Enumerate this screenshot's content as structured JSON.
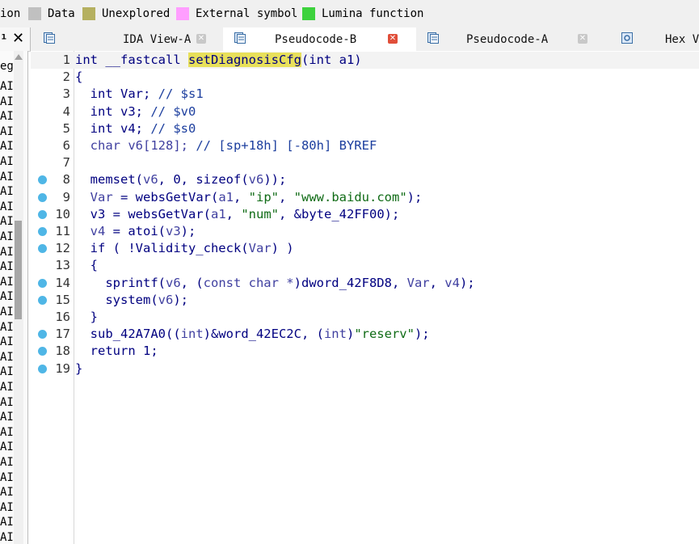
{
  "legend": [
    {
      "label": "ion",
      "color": ""
    },
    {
      "label": "Data",
      "color": "#c0c0c0"
    },
    {
      "label": "Unexplored",
      "color": "#b5b060"
    },
    {
      "label": "External symbol",
      "color": "#ff9eff"
    },
    {
      "label": "Lumina function",
      "color": "#3dd23d"
    }
  ],
  "tabs": [
    {
      "label": "IDA View-A",
      "icon": "disassembly-view-icon",
      "active": false,
      "close": "grey"
    },
    {
      "label": "Pseudocode-B",
      "icon": "pseudocode-icon",
      "active": true,
      "close": "red"
    },
    {
      "label": "Pseudocode-A",
      "icon": "pseudocode-icon",
      "active": false,
      "close": "grey"
    },
    {
      "label": "Hex V",
      "icon": "hex-view-icon",
      "active": false,
      "close": "none"
    }
  ],
  "left_panel": {
    "header_pin": "¹",
    "header_close": "✕",
    "first_row": "eg",
    "rows_text": "AI",
    "row_count": 31
  },
  "code_lines": [
    {
      "n": "1",
      "dot": false,
      "tokens": [
        [
          "kw",
          "int "
        ],
        [
          "kw",
          "__fastcall "
        ],
        [
          "hlfn",
          "setDiagnosisCfg"
        ],
        [
          "kw",
          "(int a1)"
        ]
      ]
    },
    {
      "n": "2",
      "dot": false,
      "tokens": [
        [
          "kw",
          "{"
        ]
      ]
    },
    {
      "n": "3",
      "dot": false,
      "tokens": [
        [
          "kw",
          "  int Var; "
        ],
        [
          "cm",
          "// $s1"
        ]
      ]
    },
    {
      "n": "4",
      "dot": false,
      "tokens": [
        [
          "kw",
          "  int v3; "
        ],
        [
          "cm",
          "// $v0"
        ]
      ]
    },
    {
      "n": "5",
      "dot": false,
      "tokens": [
        [
          "kw",
          "  int v4; "
        ],
        [
          "cm",
          "// $s0"
        ]
      ]
    },
    {
      "n": "6",
      "dot": false,
      "tokens": [
        [
          "var",
          "  char v6[128]; "
        ],
        [
          "cm",
          "// [sp+18h] [-80h] BYREF"
        ]
      ]
    },
    {
      "n": "7",
      "dot": false,
      "tokens": []
    },
    {
      "n": "8",
      "dot": true,
      "tokens": [
        [
          "fn",
          "  memset("
        ],
        [
          "var",
          "v6"
        ],
        [
          "fn",
          ", 0, sizeof("
        ],
        [
          "var",
          "v6"
        ],
        [
          "fn",
          "));"
        ]
      ]
    },
    {
      "n": "9",
      "dot": true,
      "tokens": [
        [
          "var",
          "  Var"
        ],
        [
          "fn",
          " = websGetVar("
        ],
        [
          "var",
          "a1"
        ],
        [
          "fn",
          ", "
        ],
        [
          "str",
          "\"ip\""
        ],
        [
          "fn",
          ", "
        ],
        [
          "str",
          "\"www.baidu.com\""
        ],
        [
          "fn",
          ");"
        ]
      ]
    },
    {
      "n": "10",
      "dot": true,
      "tokens": [
        [
          "fn",
          "  v3 = websGetVar("
        ],
        [
          "var",
          "a1"
        ],
        [
          "fn",
          ", "
        ],
        [
          "str",
          "\"num\""
        ],
        [
          "fn",
          ", &byte_42FF00);"
        ]
      ]
    },
    {
      "n": "11",
      "dot": true,
      "tokens": [
        [
          "var",
          "  v4"
        ],
        [
          "fn",
          " = atoi("
        ],
        [
          "var",
          "v3"
        ],
        [
          "fn",
          ");"
        ]
      ]
    },
    {
      "n": "12",
      "dot": true,
      "tokens": [
        [
          "fn",
          "  if ( !Validity_check("
        ],
        [
          "var",
          "Var"
        ],
        [
          "fn",
          ") )"
        ]
      ]
    },
    {
      "n": "13",
      "dot": false,
      "tokens": [
        [
          "fn",
          "  {"
        ]
      ]
    },
    {
      "n": "14",
      "dot": true,
      "tokens": [
        [
          "fn",
          "    sprintf("
        ],
        [
          "var",
          "v6"
        ],
        [
          "fn",
          ", ("
        ],
        [
          "var",
          "const char *"
        ],
        [
          "fn",
          ")dword_42F8D8, "
        ],
        [
          "var",
          "Var"
        ],
        [
          "fn",
          ", "
        ],
        [
          "var",
          "v4"
        ],
        [
          "fn",
          ");"
        ]
      ]
    },
    {
      "n": "15",
      "dot": true,
      "tokens": [
        [
          "fn",
          "    system("
        ],
        [
          "var",
          "v6"
        ],
        [
          "fn",
          ");"
        ]
      ]
    },
    {
      "n": "16",
      "dot": false,
      "tokens": [
        [
          "fn",
          "  }"
        ]
      ]
    },
    {
      "n": "17",
      "dot": true,
      "tokens": [
        [
          "fn",
          "  sub_42A7A0(("
        ],
        [
          "var",
          "int"
        ],
        [
          "fn",
          ")&word_42EC2C, ("
        ],
        [
          "var",
          "int"
        ],
        [
          "fn",
          ")"
        ],
        [
          "str",
          "\"reserv\""
        ],
        [
          "fn",
          ");"
        ]
      ]
    },
    {
      "n": "18",
      "dot": true,
      "tokens": [
        [
          "fn",
          "  return 1;"
        ]
      ]
    },
    {
      "n": "19",
      "dot": true,
      "tokens": [
        [
          "fn",
          "}"
        ]
      ]
    }
  ],
  "colors": {
    "dot": "#4fb6e6",
    "highlight": "#e8e05a"
  }
}
